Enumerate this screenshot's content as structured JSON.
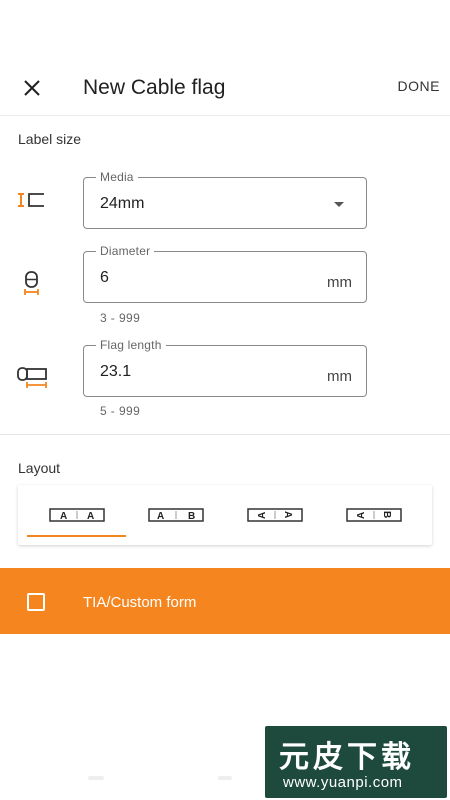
{
  "appbar": {
    "title": "New Cable flag",
    "done_label": "DONE"
  },
  "label_size": {
    "heading": "Label size",
    "media": {
      "label": "Media",
      "value": "24mm"
    },
    "diameter": {
      "label": "Diameter",
      "value": "6",
      "unit": "mm",
      "helper": "3 - 999"
    },
    "flag_length": {
      "label": "Flag length",
      "value": "23.1",
      "unit": "mm",
      "helper": "5 - 999"
    }
  },
  "layout": {
    "heading": "Layout",
    "options": [
      {
        "left": "A",
        "right": "A",
        "selected": true
      },
      {
        "left": "A",
        "right": "B",
        "selected": false
      },
      {
        "left": "A",
        "right": "A",
        "rotated": true,
        "selected": false
      },
      {
        "left": "A",
        "right": "B",
        "rotated": true,
        "selected": false
      }
    ]
  },
  "tia_custom": {
    "label": "TIA/Custom form",
    "checked": false
  },
  "watermark": {
    "brand": "元皮下载",
    "url": "www.yuanpi.com"
  },
  "colors": {
    "accent": "#f5861f",
    "watermark_bg": "#1d4a3c"
  },
  "icons": [
    "close-icon",
    "media-width-icon",
    "cable-diameter-icon",
    "flag-length-icon",
    "checkbox-icon",
    "dropdown-caret-icon"
  ]
}
